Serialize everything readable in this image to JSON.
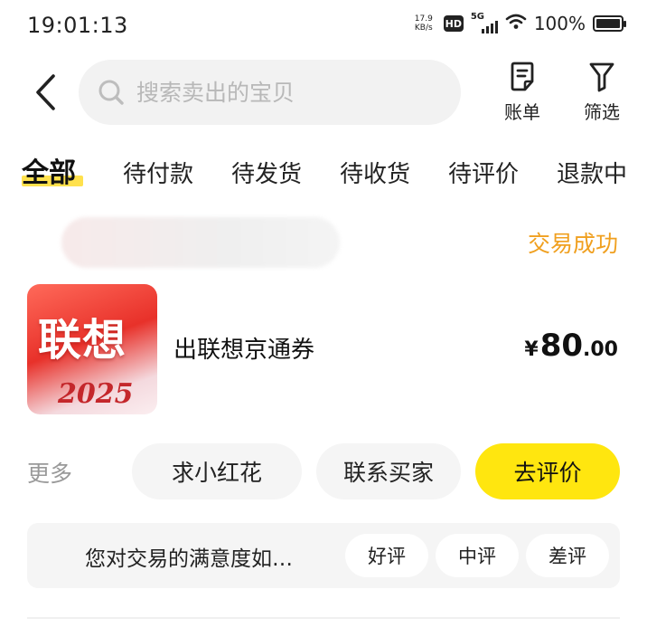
{
  "status_bar": {
    "time": "19:01:13",
    "net_speed_value": "17.9",
    "net_speed_unit": "KB/s",
    "hd_label": "HD",
    "network_type": "5G",
    "battery_percent": "100%"
  },
  "header": {
    "search_placeholder": "搜索卖出的宝贝",
    "bill_label": "账单",
    "filter_label": "筛选"
  },
  "tabs": {
    "items": [
      {
        "label": "全部",
        "active": true
      },
      {
        "label": "待付款",
        "active": false
      },
      {
        "label": "待发货",
        "active": false
      },
      {
        "label": "待收货",
        "active": false
      },
      {
        "label": "待评价",
        "active": false
      },
      {
        "label": "退款中",
        "active": false
      }
    ]
  },
  "order": {
    "status": "交易成功",
    "thumbnail": {
      "title": "联想",
      "year": "2025"
    },
    "product_title": "出联想京通券",
    "price": {
      "currency": "¥",
      "integer": "80",
      "decimal": ".00"
    }
  },
  "actions": {
    "more": "更多",
    "request_flower": "求小红花",
    "contact_buyer": "联系买家",
    "go_review": "去评价"
  },
  "satisfaction": {
    "question": "您对交易的满意度如…",
    "good": "好评",
    "neutral": "中评",
    "bad": "差评"
  },
  "colors": {
    "accent_yellow": "#ffe60f",
    "tab_underline": "#ffe14d",
    "status_orange": "#f0a020",
    "muted_text": "#999999"
  }
}
